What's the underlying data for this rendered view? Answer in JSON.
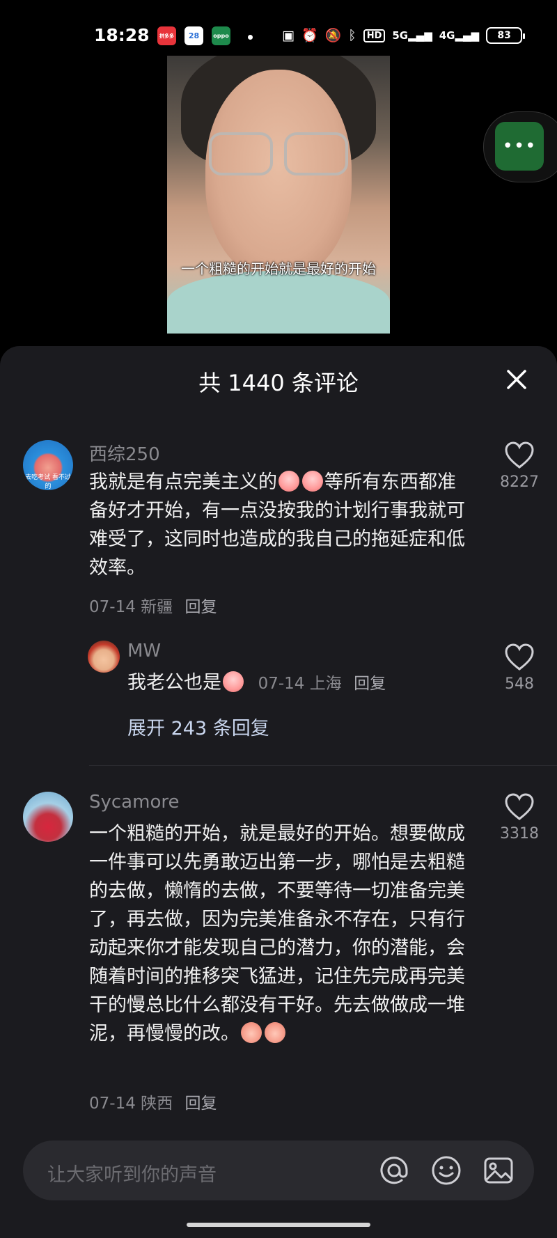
{
  "status_bar": {
    "time": "18:28",
    "app_badges": [
      "拼多多",
      "28",
      "oppo"
    ],
    "indicators": [
      "nfc-icon",
      "alarm-icon",
      "mute-icon",
      "bluetooth-icon",
      "HD",
      "5G",
      "4G"
    ],
    "hd_label": "HD",
    "net_5g": "5G",
    "net_4g": "4G",
    "battery": "83"
  },
  "video": {
    "caption": "一个粗糙的开始就是最好的开始"
  },
  "comments_sheet": {
    "title": "共 1440 条评论",
    "comments": [
      {
        "user": "西综250",
        "text_parts": [
          "我就是有点完美主义的",
          "等所有东西都准备好才开始，有一点没按我的计划行事我就可难受了，这同时也造成的我自己的拖延症和低效率。"
        ],
        "date": "07-14",
        "location": "新疆",
        "reply_label": "回复",
        "likes": "8227",
        "avatar_text": "去吃考试\n看不过的"
      },
      {
        "user": "MW",
        "text": "我老公也是",
        "date": "07-14",
        "location": "上海",
        "reply_label": "回复",
        "likes": "548"
      },
      {
        "user": "Sycamore",
        "text": "一个粗糙的开始，就是最好的开始。想要做成一件事可以先勇敢迈出第一步，哪怕是去粗糙的去做，懒惰的去做，不要等待一切准备完美了，再去做，因为完美准备永不存在，只有行动起来你才能发现自己的潜力，你的潜能，会随着时间的推移突飞猛进，记住先完成再完美干的慢总比什么都没有干好。先去做做成一堆泥，再慢慢的改。",
        "date": "07-14",
        "location": "陕西",
        "reply_label": "回复",
        "likes": "3318"
      }
    ],
    "expand_replies": "展开 243 条回复"
  },
  "input_bar": {
    "placeholder": "让大家听到你的声音"
  },
  "colors": {
    "sheet_bg": "#1b1b1f",
    "muted_text": "#8a8a8f",
    "float_button": "#1f6b33"
  }
}
